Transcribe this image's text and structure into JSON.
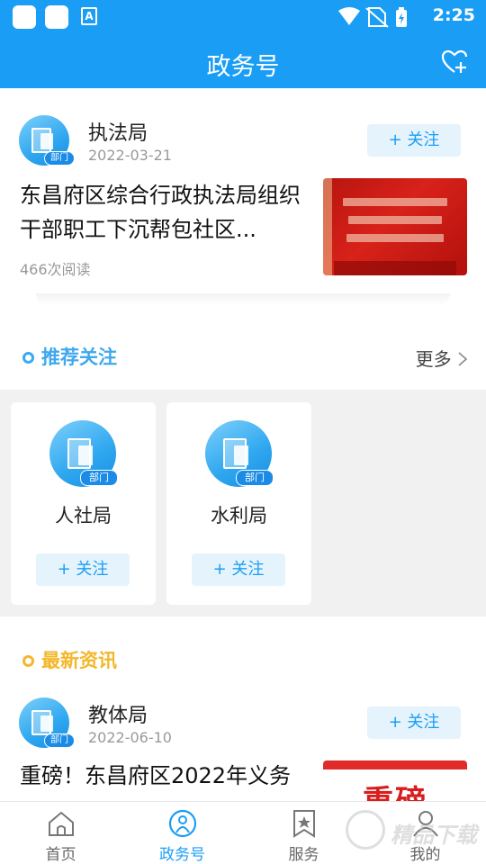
{
  "status_bar": {
    "time": "2:25",
    "app_icon_letter": "A"
  },
  "header": {
    "title": "政务号",
    "favorite_icon": "heart-plus-icon"
  },
  "feed": [
    {
      "org": "执法局",
      "date": "2022-03-21",
      "follow_label": "+ 关注",
      "title": "东昌府区综合行政执法局组织干部职工下沉帮包社区...",
      "reads": "466次阅读"
    },
    {
      "org": "教体局",
      "date": "2022-06-10",
      "follow_label": "+ 关注",
      "title": "重磅！东昌府区2022年义务",
      "thumb_text": "重磅"
    }
  ],
  "avatar_badge": "部门",
  "recommend": {
    "title": "推荐关注",
    "more_label": "更多",
    "items": [
      {
        "name": "人社局",
        "follow_label": "+ 关注"
      },
      {
        "name": "水利局",
        "follow_label": "+ 关注"
      }
    ]
  },
  "latest": {
    "title": "最新资讯"
  },
  "bottom_nav": [
    {
      "label": "首页",
      "icon": "home-icon"
    },
    {
      "label": "政务号",
      "icon": "gov-account-icon",
      "active": true
    },
    {
      "label": "服务",
      "icon": "bookmark-star-icon"
    },
    {
      "label": "我的",
      "icon": "user-icon"
    }
  ],
  "watermark": "精品下载",
  "colors": {
    "primary": "#1a9ef5",
    "accent_yellow": "#f3b72b",
    "follow_bg": "#e5f3fd"
  }
}
